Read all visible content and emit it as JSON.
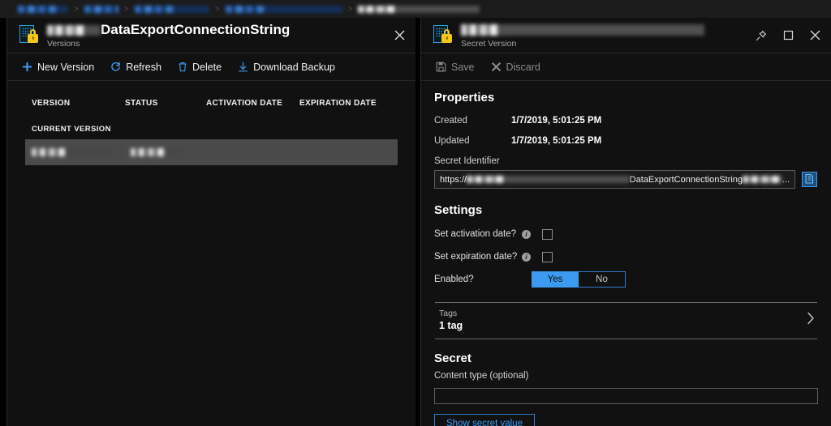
{
  "breadcrumb": {
    "items": [
      {
        "label": "",
        "redacted": true,
        "kind": "link",
        "width": 62
      },
      {
        "label": "",
        "redacted": true,
        "kind": "link",
        "width": 42
      },
      {
        "label": "",
        "redacted": true,
        "kind": "link",
        "width": 92
      },
      {
        "label": "",
        "redacted": true,
        "kind": "link",
        "width": 144
      },
      {
        "label": "",
        "redacted": true,
        "kind": "current",
        "width": 150
      }
    ],
    "separator": ">"
  },
  "left_blade": {
    "icon": "key-vault-secret-icon",
    "title_redacted_prefix": true,
    "title": "DataExportConnectionString",
    "subtitle": "Versions",
    "close_icon": "close-icon",
    "toolbar": [
      {
        "label": "New Version",
        "icon": "plus-icon",
        "disabled": false
      },
      {
        "label": "Refresh",
        "icon": "refresh-icon",
        "disabled": false
      },
      {
        "label": "Delete",
        "icon": "trash-icon",
        "disabled": false
      },
      {
        "label": "Download Backup",
        "icon": "download-icon",
        "disabled": false
      }
    ],
    "table": {
      "columns": [
        "VERSION",
        "STATUS",
        "ACTIVATION DATE",
        "EXPIRATION DATE"
      ],
      "group_label": "CURRENT VERSION",
      "rows": [
        {
          "version": "",
          "status": "",
          "activation_date": "",
          "expiration_date": "",
          "redacted": true,
          "selected": true
        }
      ]
    }
  },
  "right_blade": {
    "icon": "key-vault-secret-icon",
    "title": "",
    "title_redacted": true,
    "subtitle": "Secret Version",
    "window_controls": [
      {
        "icon": "pin-icon"
      },
      {
        "icon": "maximize-icon"
      },
      {
        "icon": "close-icon"
      }
    ],
    "toolbar": [
      {
        "label": "Save",
        "icon": "save-icon",
        "disabled": true
      },
      {
        "label": "Discard",
        "icon": "discard-icon",
        "disabled": true
      }
    ],
    "properties": {
      "heading": "Properties",
      "created_label": "Created",
      "created_value": "1/7/2019, 5:01:25 PM",
      "updated_label": "Updated",
      "updated_value": "1/7/2019, 5:01:25 PM",
      "secret_identifier_label": "Secret Identifier",
      "secret_identifier_prefix": "https://",
      "secret_identifier_middle": "DataExportConnectionString",
      "secret_identifier_suffix": "...",
      "copy_icon": "copy-icon"
    },
    "settings": {
      "heading": "Settings",
      "activation_label": "Set activation date?",
      "activation_checked": false,
      "expiration_label": "Set expiration date?",
      "expiration_checked": false,
      "enabled_label": "Enabled?",
      "enabled_yes": "Yes",
      "enabled_no": "No",
      "enabled_value": "Yes",
      "info_glyph": "i"
    },
    "tags": {
      "label": "Tags",
      "value": "1 tag",
      "chevron_icon": "chevron-right-icon"
    },
    "secret": {
      "heading": "Secret",
      "content_type_label": "Content type (optional)",
      "content_type_value": "",
      "show_secret_button": "Show secret value"
    }
  },
  "colors": {
    "accent_blue": "#3c9bf0",
    "link_blue": "#4aa0e8",
    "background": "#000000",
    "blade_background": "#111111",
    "selected_row": "#4a4a4a",
    "lock_gold": "#f5c518"
  }
}
